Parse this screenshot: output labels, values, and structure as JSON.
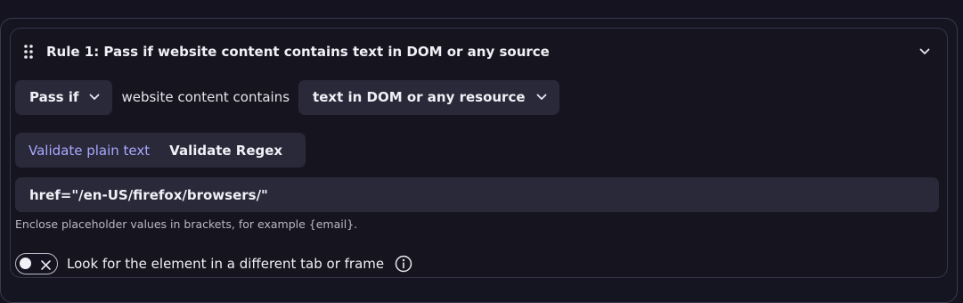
{
  "rule": {
    "title": "Rule 1: Pass if website content contains text in DOM or any source"
  },
  "condition": {
    "mode_select": "Pass if",
    "connector_text": "website content contains",
    "source_select": "text in DOM or any resource"
  },
  "validation_tabs": {
    "active": "Validate plain text",
    "items": [
      "Validate plain text",
      "Validate Regex"
    ]
  },
  "text_input": {
    "value": "href=\"/en-US/firefox/browsers/\""
  },
  "hint": "Enclose placeholder values in brackets, for example {email}.",
  "toggle": {
    "label": "Look for the element in a different tab or frame",
    "state": "off"
  },
  "icons": {
    "drag": "drag-handle-icon",
    "collapse": "chevron-down-icon",
    "info": "info-icon",
    "toggle_off": "x-icon"
  },
  "colors": {
    "accent": "#a9a7ff",
    "field_bg": "#2a2939",
    "page_bg": "#14131f"
  }
}
